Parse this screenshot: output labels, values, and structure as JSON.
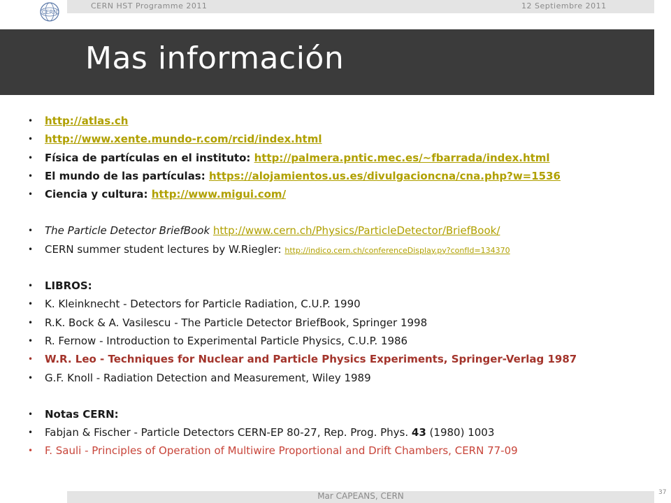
{
  "header": {
    "left": "CERN HST Programme 2011",
    "right": "12 Septiembre 2011"
  },
  "title": "Mas información",
  "items": [
    {
      "link": "http://atlas.ch"
    },
    {
      "link": "http://www.xente.mundo-r.com/rcid/index.html"
    },
    {
      "prefix": "Física de partículas en el instituto: ",
      "link": "http://palmera.pntic.mec.es/~fbarrada/index.html"
    },
    {
      "prefix": "El mundo de las partículas: ",
      "link": "https://alojamientos.us.es/divulgacioncna/cna.php?w=1536"
    },
    {
      "prefix": "Ciencia y cultura: ",
      "link": "http://www.migui.com/"
    },
    {
      "prefix": "The Particle Detector BriefBook ",
      "link": "http://www.cern.ch/Physics/ParticleDetector/BriefBook/"
    },
    {
      "prefix": "CERN summer student lectures by W.Riegler: ",
      "link": "http://indico.cern.ch/conferenceDisplay.py?confId=134370"
    },
    {
      "text": "LIBROS:"
    },
    {
      "text": "K. Kleinknecht - Detectors for Particle Radiation, C.U.P. 1990"
    },
    {
      "text": "R.K. Bock & A. Vasilescu - The Particle Detector BriefBook, Springer 1998"
    },
    {
      "text": "R. Fernow - Introduction to Experimental Particle Physics, C.U.P. 1986"
    },
    {
      "text": "W.R. Leo - Techniques for Nuclear and Particle Physics Experiments, Springer-Verlag 1987"
    },
    {
      "text": "G.F. Knoll - Radiation Detection and Measurement, Wiley 1989"
    },
    {
      "text": "Notas CERN:"
    },
    {
      "text_a": "Fabjan & Fischer - Particle Detectors CERN-EP 80-27, Rep. Prog. Phys. ",
      "text_b": "43",
      "text_c": " (1980) 1003"
    },
    {
      "text": "F. Sauli - Principles of Operation of Multiwire Proportional and Drift Chambers, CERN 77-09"
    }
  ],
  "bullet": "•",
  "footer": {
    "author": "Mar CAPEANS, CERN",
    "page": "37"
  },
  "colors": {
    "title_bar": "#3b3b3b",
    "link": "#b0a000",
    "highlight_dark_red": "#a3342b",
    "highlight_red": "#c8453a"
  }
}
